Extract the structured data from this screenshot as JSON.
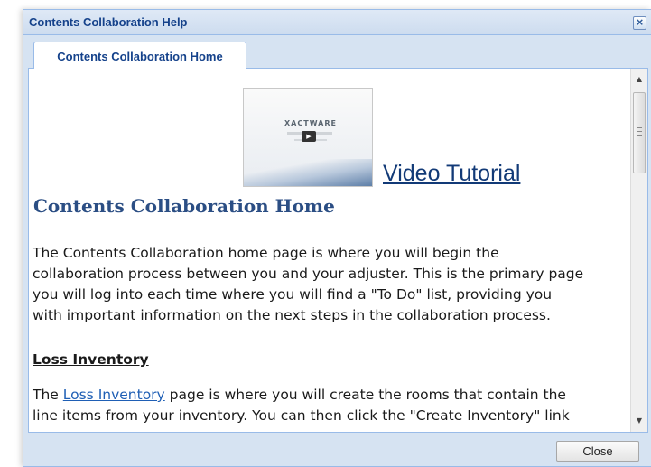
{
  "window": {
    "title": "Contents Collaboration Help"
  },
  "tabs": [
    {
      "label": "Contents Collaboration Home",
      "active": true
    }
  ],
  "content": {
    "video_thumbnail": {
      "brand_text": "XACTWARE"
    },
    "video_link": "Video Tutorial",
    "heading": "Contents Collaboration Home",
    "intro_lines": [
      "The Contents Collaboration home page is where you will begin the",
      "collaboration process between you and your adjuster. This is the primary page",
      "you will log into each time where you will find a \"To Do\" list, providing you",
      "with important information on the next steps in the collaboration process."
    ],
    "section_heading": "Loss Inventory",
    "loss_inventory": {
      "pre_link": "The ",
      "link_text": "Loss Inventory",
      "line1_rest": " page is where you will create the rooms that contain the",
      "line2": "line items from your inventory. You can then click the \"Create Inventory\" link"
    }
  },
  "footer": {
    "close_button": "Close"
  },
  "icons": {
    "window_close": "close-icon",
    "scroll_up": "scroll-up-arrow-icon",
    "scroll_down": "scroll-down-arrow-icon",
    "play": "play-icon"
  },
  "colors": {
    "title_text": "#15428b",
    "heading": "#2b4e84",
    "link": "#1f5fb5",
    "frame": "#d6e3f2"
  }
}
